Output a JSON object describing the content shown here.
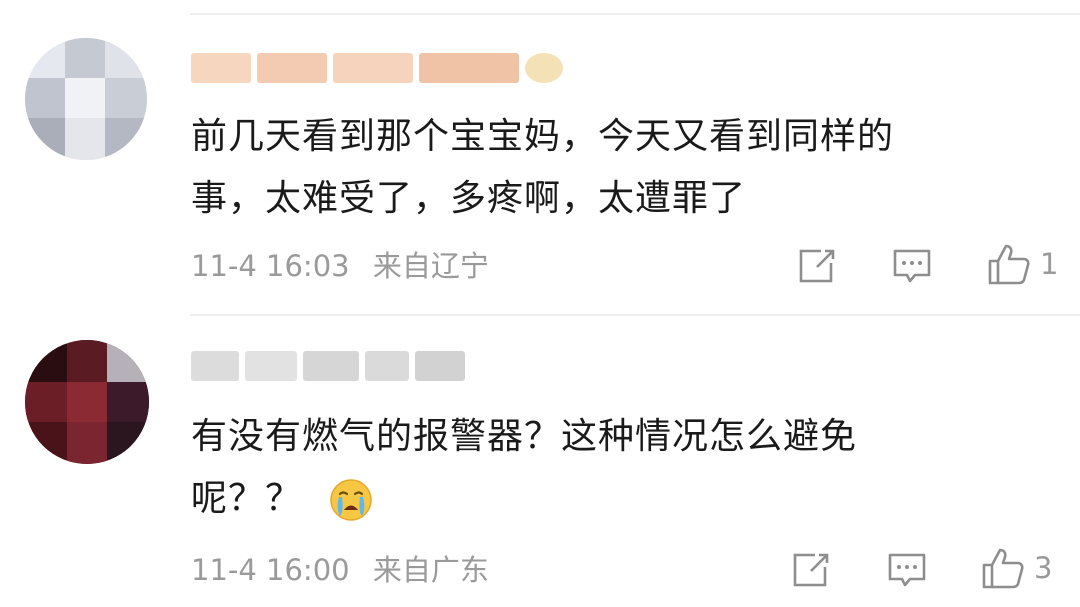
{
  "comments": [
    {
      "text_line1": "前几天看到那个宝宝妈，今天又看到同样的",
      "text_line2": "事，太难受了，多疼啊，太遭罪了",
      "time": "11-4 16:03",
      "location": "来自辽宁",
      "like_count": "1",
      "username_badge_color": "#e8b43c"
    },
    {
      "text_line1": "有没有燃气的报警器？这种情况怎么避免",
      "text_line2": "呢？？",
      "time": "11-4 16:00",
      "location": "来自广东",
      "like_count": "3",
      "emoji": "crying-face-icon"
    }
  ],
  "icons": {
    "forward": "forward-icon",
    "comment": "comment-icon",
    "like": "thumbs-up-icon"
  },
  "colors": {
    "text": "#1a1a1a",
    "meta": "#9a9a9a",
    "divider": "#eeeeee",
    "username_blur_1": "#f6dcc8",
    "username_blur_2": "#d8d8d8"
  }
}
